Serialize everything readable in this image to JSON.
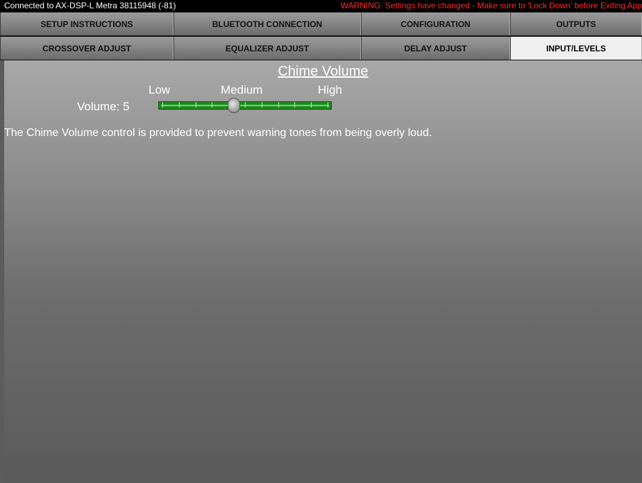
{
  "status": {
    "connection": "Connected to AX-DSP-L Metra 38115948 (-81)",
    "warning": "WARNING: Settings have changed - Make sure to 'Lock Down' before Exiting App"
  },
  "tabs": {
    "row1": [
      "SETUP INSTRUCTIONS",
      "BLUETOOTH CONNECTION",
      "CONFIGURATION",
      "OUTPUTS"
    ],
    "row2": [
      "CROSSOVER ADJUST",
      "EQUALIZER ADJUST",
      "DELAY ADJUST",
      "INPUT/LEVELS"
    ],
    "active": "INPUT/LEVELS"
  },
  "main": {
    "title": "Chime Volume",
    "levels": {
      "low": "Low",
      "medium": "Medium",
      "high": "High"
    },
    "volume_label": "Volume:",
    "volume_value": "5",
    "slider": {
      "min": 0,
      "max": 10,
      "value": 5
    },
    "description": "The Chime Volume control is provided to prevent warning tones from being overly loud."
  },
  "colors": {
    "warning_text": "#ff2a2a",
    "slider_track": "#1f8a1f",
    "active_tab": "#efefef"
  }
}
